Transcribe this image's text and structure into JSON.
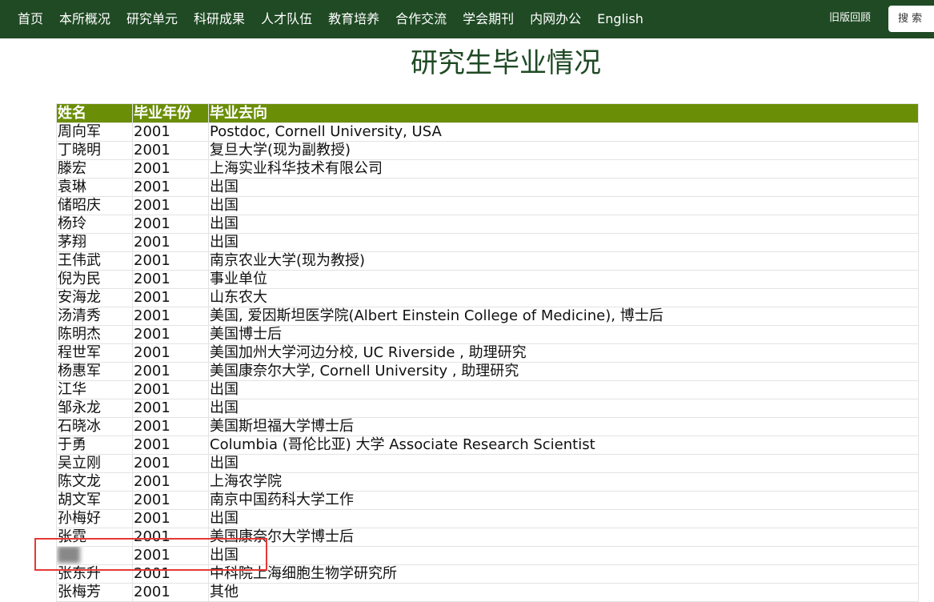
{
  "nav": {
    "items": [
      "首页",
      "本所概况",
      "研究单元",
      "科研成果",
      "人才队伍",
      "教育培养",
      "合作交流",
      "学会期刊",
      "内网办公",
      "English"
    ],
    "old_version": "旧版回顾",
    "search_label": "搜 索"
  },
  "page": {
    "title": "研究生毕业情况"
  },
  "table": {
    "headers": [
      "姓名",
      "毕业年份",
      "毕业去向"
    ],
    "rows": [
      [
        "周向军",
        "2001",
        "Postdoc, Cornell University, USA"
      ],
      [
        "丁晓明",
        "2001",
        "复旦大学(现为副教授)"
      ],
      [
        "滕宏",
        "2001",
        "上海实业科华技术有限公司"
      ],
      [
        "袁琳",
        "2001",
        "出国"
      ],
      [
        "储昭庆",
        "2001",
        "出国"
      ],
      [
        "杨玲",
        "2001",
        "出国"
      ],
      [
        "茅翔",
        "2001",
        "出国"
      ],
      [
        "王伟武",
        "2001",
        "南京农业大学(现为教授)"
      ],
      [
        "倪为民",
        "2001",
        "事业单位"
      ],
      [
        "安海龙",
        "2001",
        "山东农大"
      ],
      [
        "汤清秀",
        "2001",
        "美国, 爱因斯坦医学院(Albert Einstein College of Medicine), 博士后"
      ],
      [
        "陈明杰",
        "2001",
        "美国博士后"
      ],
      [
        "程世军",
        "2001",
        "美国加州大学河边分校, UC Riverside , 助理研究"
      ],
      [
        "杨惠军",
        "2001",
        "美国康奈尔大学, Cornell University , 助理研究"
      ],
      [
        "江华",
        "2001",
        "出国"
      ],
      [
        "邹永龙",
        "2001",
        "出国"
      ],
      [
        "石晓冰",
        "2001",
        "美国斯坦福大学博士后"
      ],
      [
        "于勇",
        "2001",
        "Columbia (哥伦比亚) 大学 Associate Research Scientist"
      ],
      [
        "吴立刚",
        "2001",
        "出国"
      ],
      [
        "陈文龙",
        "2001",
        "上海农学院"
      ],
      [
        "胡文军",
        "2001",
        "南京中国药科大学工作"
      ],
      [
        "孙梅好",
        "2001",
        "出国"
      ],
      [
        "张霓",
        "2001",
        "美国康奈尔大学博士后"
      ],
      [
        "",
        "2001",
        "出国"
      ],
      [
        "张东升",
        "2001",
        "中科院上海细胞生物学研究所"
      ],
      [
        "张梅芳",
        "2001",
        "其他"
      ]
    ]
  }
}
